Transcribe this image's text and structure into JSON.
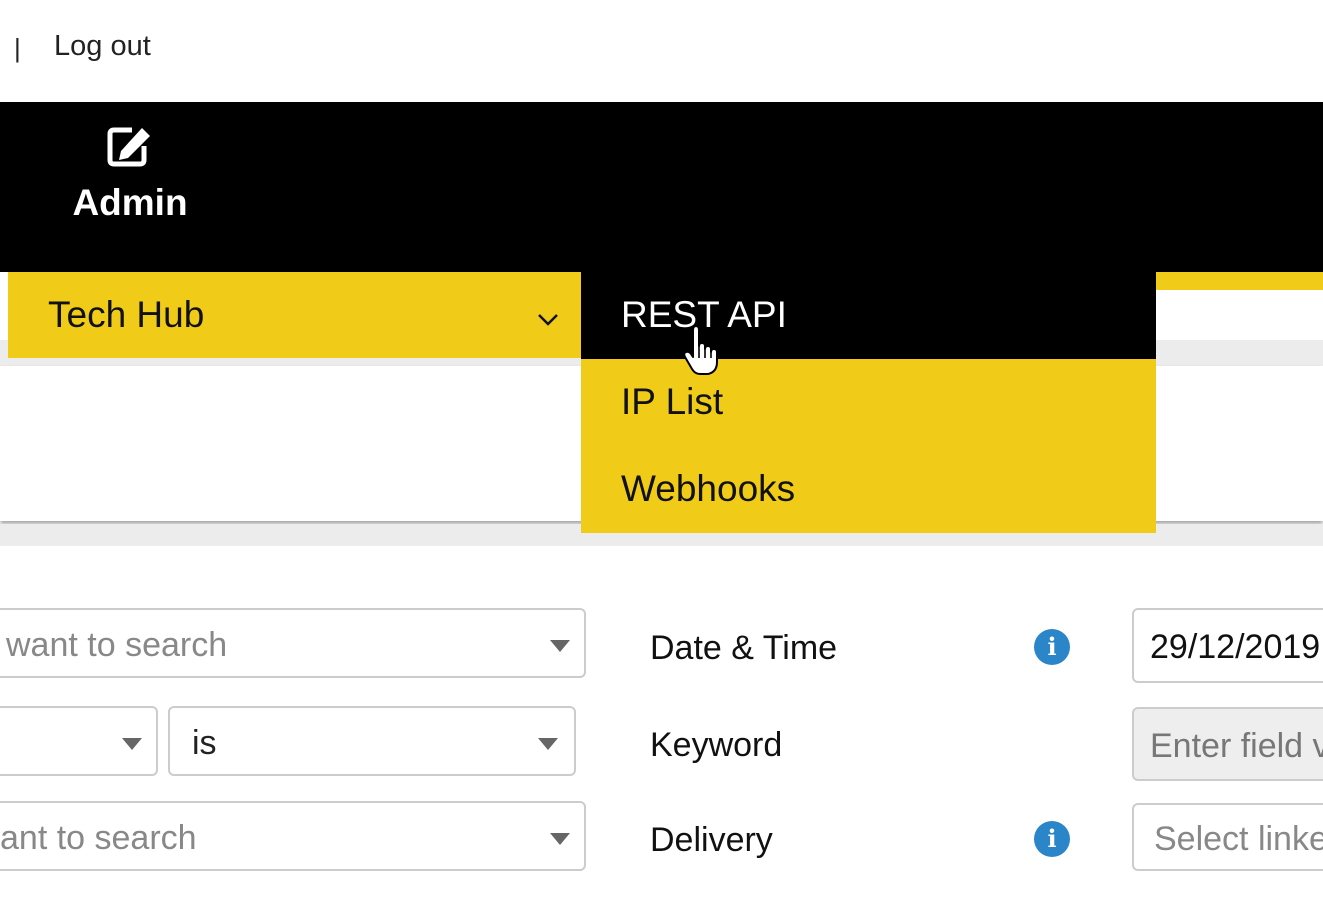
{
  "topbar": {
    "separator": "|",
    "logout_label": "Log out"
  },
  "nav": {
    "admin_label": "Admin",
    "admin_icon": "edit-icon"
  },
  "subnav": {
    "tech_hub_label": "Tech Hub"
  },
  "dropdown": {
    "items": [
      {
        "label": "REST API"
      },
      {
        "label": "IP List"
      },
      {
        "label": "Webhooks"
      }
    ]
  },
  "colors": {
    "accent": "#f0cc18",
    "nav_bg": "#000000",
    "info": "#2a86c8"
  },
  "search": {
    "field1_placeholder": "want to search",
    "operator_value": "is",
    "field3_placeholder": "ant to search"
  },
  "filters": {
    "date_label": "Date & Time",
    "date_value": "29/12/2019",
    "keyword_label": "Keyword",
    "keyword_placeholder": "Enter field v",
    "delivery_label": "Delivery",
    "delivery_placeholder": "Select linke",
    "info_glyph": "i"
  }
}
